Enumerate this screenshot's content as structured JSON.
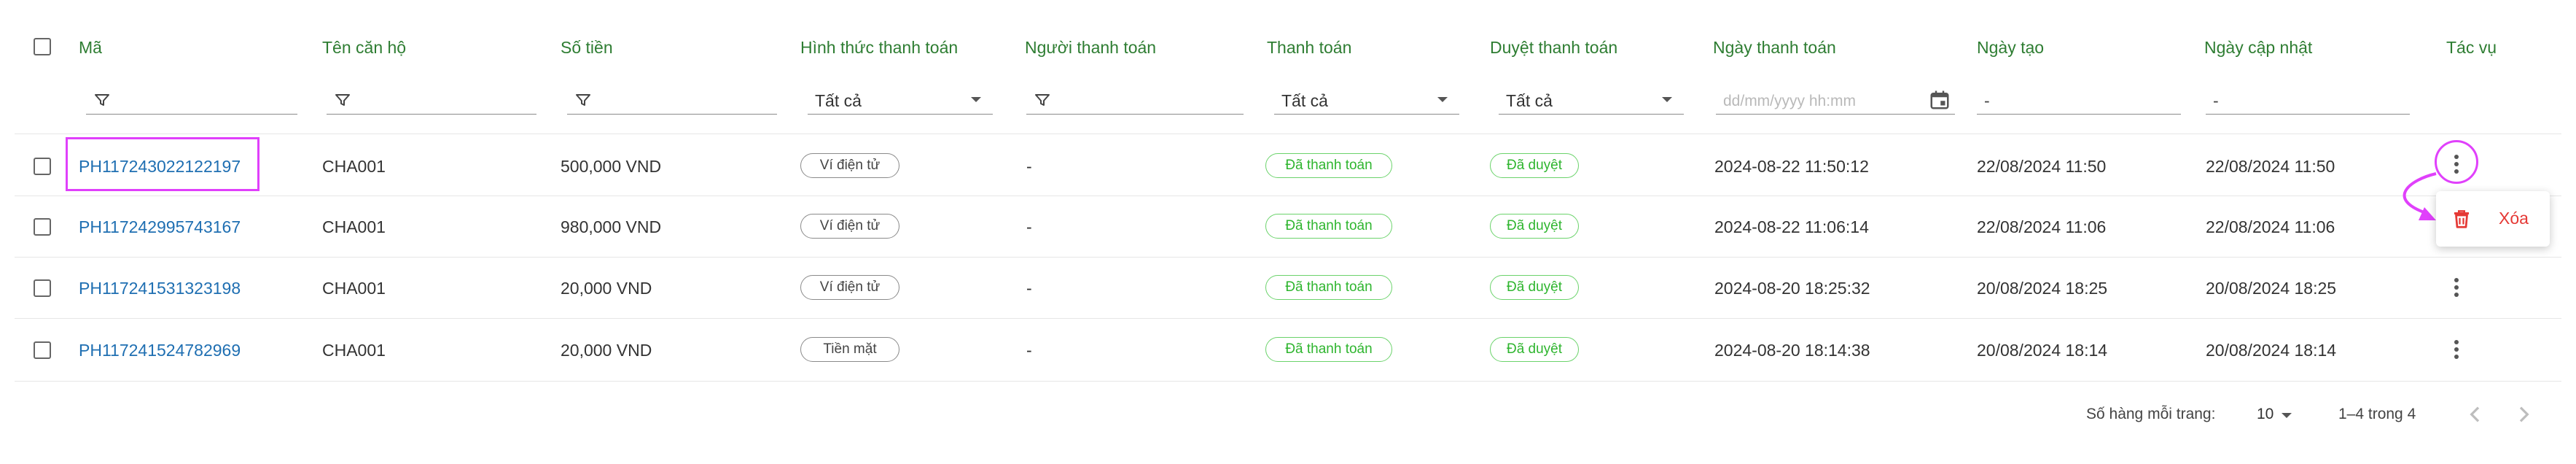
{
  "columns": {
    "code": "Mã",
    "apartment": "Tên căn hộ",
    "amount": "Số tiền",
    "method": "Hình thức thanh toán",
    "payer": "Người thanh toán",
    "paid": "Thanh toán",
    "approval": "Duyệt thanh toán",
    "pay_date": "Ngày thanh toán",
    "created": "Ngày tạo",
    "updated": "Ngày cập nhật",
    "actions": "Tác vụ"
  },
  "filters": {
    "method": "Tất cả",
    "paid": "Tất cả",
    "approval": "Tất cả",
    "date_placeholder": "dd/mm/yyyy hh:mm",
    "created": "-",
    "updated": "-"
  },
  "rows": [
    {
      "code": "PH117243022122197",
      "apartment": "CHA001",
      "amount": "500,000 VND",
      "method": "Ví điện tử",
      "payer": "-",
      "paid": "Đã thanh toán",
      "approval": "Đã duyệt",
      "pay_date": "2024-08-22 11:50:12",
      "created": "22/08/2024 11:50",
      "updated": "22/08/2024 11:50"
    },
    {
      "code": "PH117242995743167",
      "apartment": "CHA001",
      "amount": "980,000 VND",
      "method": "Ví điện tử",
      "payer": "-",
      "paid": "Đã thanh toán",
      "approval": "Đã duyệt",
      "pay_date": "2024-08-22 11:06:14",
      "created": "22/08/2024 11:06",
      "updated": "22/08/2024 11:06"
    },
    {
      "code": "PH117241531323198",
      "apartment": "CHA001",
      "amount": "20,000 VND",
      "method": "Ví điện tử",
      "payer": "-",
      "paid": "Đã thanh toán",
      "approval": "Đã duyệt",
      "pay_date": "2024-08-20 18:25:32",
      "created": "20/08/2024 18:25",
      "updated": "20/08/2024 18:25"
    },
    {
      "code": "PH117241524782969",
      "apartment": "CHA001",
      "amount": "20,000 VND",
      "method": "Tiền mặt",
      "payer": "-",
      "paid": "Đã thanh toán",
      "approval": "Đã duyệt",
      "pay_date": "2024-08-20 18:14:38",
      "created": "20/08/2024 18:14",
      "updated": "20/08/2024 18:14"
    }
  ],
  "context_menu": {
    "delete": "Xóa"
  },
  "pagination": {
    "rows_per_page_label": "Số hàng mỗi trang:",
    "rows_per_page": "10",
    "range": "1–4 trong 4"
  },
  "colors": {
    "header_text": "#2e7d32",
    "link": "#1f6fb2",
    "chip_green": "#2fb52f",
    "delete_red": "#e53935",
    "highlight": "#e040fb"
  },
  "icons": [
    "filter-icon",
    "calendar-icon",
    "dropdown-caret-icon",
    "more-vert-icon",
    "trash-icon",
    "chevron-left-icon",
    "chevron-right-icon",
    "checkbox-icon"
  ]
}
